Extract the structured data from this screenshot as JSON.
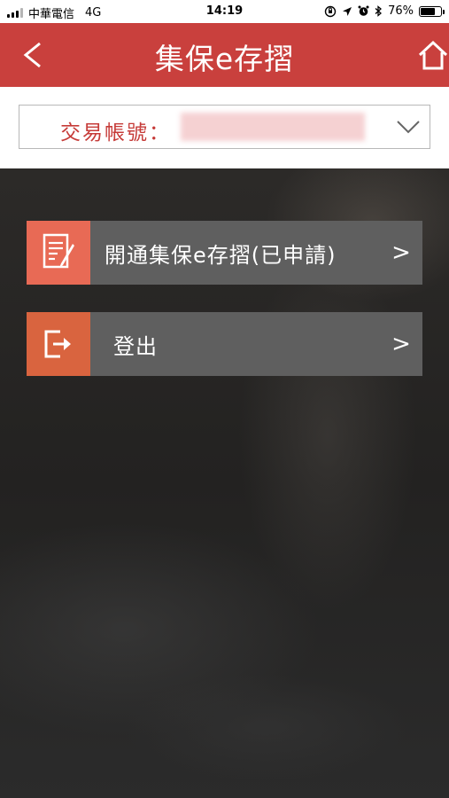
{
  "status_bar": {
    "carrier": "中華電信",
    "network": "4G",
    "time": "14:19",
    "battery": "76%",
    "battery_level": 0.76
  },
  "header": {
    "back_label": "<",
    "title": "集保e存摺",
    "background_color": "#c9403d"
  },
  "account": {
    "label": "交易帳號："
  },
  "menu": {
    "items": [
      {
        "label": "開通集保e存摺(已申請)",
        "arrow": ">",
        "icon": "document-edit-icon",
        "icon_color": "#e86a55"
      },
      {
        "label": "登出",
        "arrow": ">",
        "icon": "logout-icon",
        "icon_color": "#d9643f"
      }
    ]
  }
}
